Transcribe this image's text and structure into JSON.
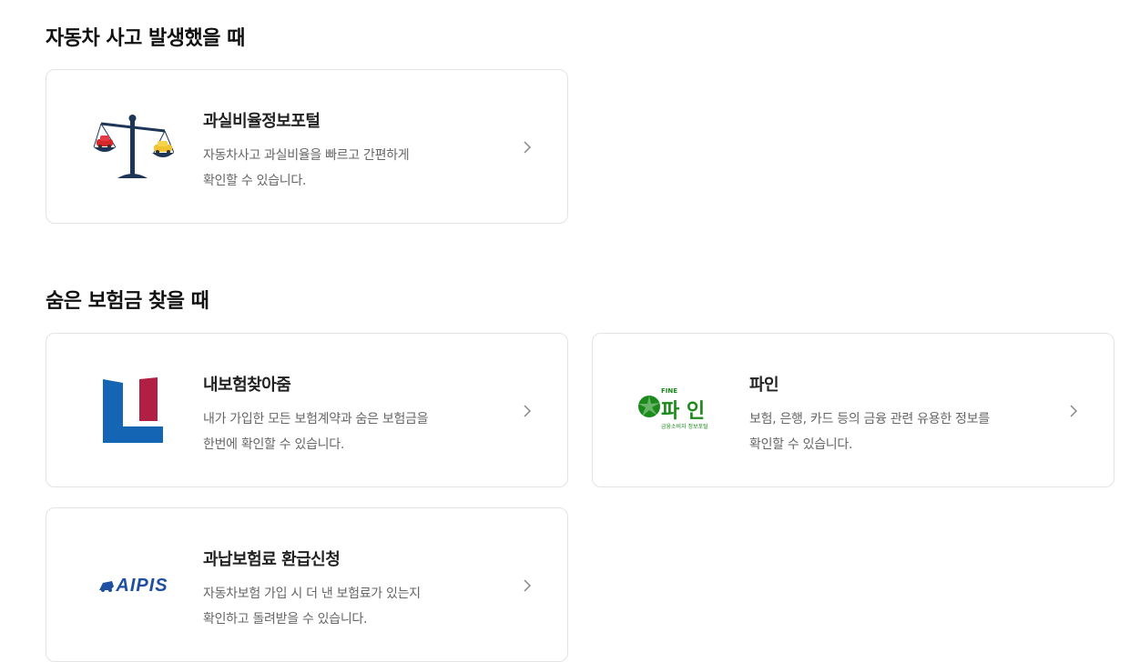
{
  "sections": [
    {
      "title": "자동차 사고 발생했을 때",
      "cards": [
        {
          "title": "과실비율정보포털",
          "desc": [
            "자동차사고 과실비율을 빠르고 간편하게",
            "확인할 수 있습니다."
          ],
          "icon": "scale-logo"
        }
      ]
    },
    {
      "title": "숨은 보험금 찾을 때",
      "cards": [
        {
          "title": "내보험찾아줌",
          "desc": [
            "내가 가입한 모든 보험계약과 숨은 보험금을",
            "한번에 확인할 수 있습니다."
          ],
          "icon": "naebohum-logo"
        },
        {
          "title": "파인",
          "desc": [
            "보험, 은행, 카드 등의 금융 관련 유용한 정보를",
            "확인할 수 있습니다."
          ],
          "icon": "fine-logo",
          "logo_text": {
            "top": "FINE",
            "main": "파 인",
            "sub": "금융소비자 정보포털"
          }
        },
        {
          "title": "과납보험료 환급신청",
          "desc": [
            "자동차보험 가입 시 더 낸 보험료가 있는지",
            "확인하고 돌려받을 수 있습니다."
          ],
          "icon": "aipis-logo",
          "logo_text": {
            "main": "AIPIS"
          }
        }
      ]
    }
  ],
  "colors": {
    "fine_green": "#1a8a1a",
    "aipis_blue": "#1f4fa0",
    "naebohum_blue": "#1565b5",
    "naebohum_red": "#b21f45",
    "scale_navy": "#1d3557"
  }
}
